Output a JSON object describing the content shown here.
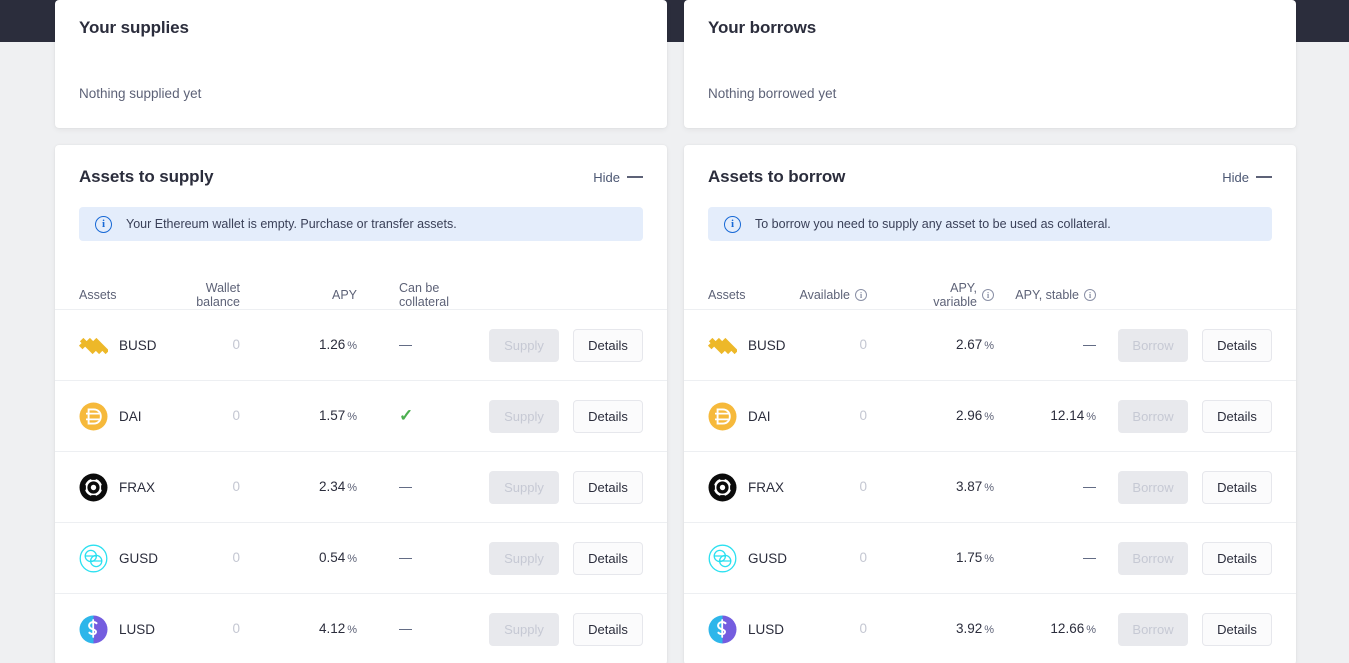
{
  "supplies_panel": {
    "title": "Your supplies",
    "empty_text": "Nothing supplied yet"
  },
  "borrows_panel": {
    "title": "Your borrows",
    "empty_text": "Nothing borrowed yet"
  },
  "supply_table": {
    "title": "Assets to supply",
    "hide_label": "Hide",
    "alert": "Your Ethereum wallet is empty. Purchase or transfer assets.",
    "headers": {
      "assets": "Assets",
      "wallet_balance": "Wallet balance",
      "apy": "APY",
      "can_be_collateral": "Can be collateral"
    },
    "action_label": "Supply",
    "details_label": "Details",
    "rows": [
      {
        "symbol": "BUSD",
        "icon": "busd-icon",
        "balance": "0",
        "apy": "1.26",
        "unit": "%",
        "collateral": "no"
      },
      {
        "symbol": "DAI",
        "icon": "dai-icon",
        "balance": "0",
        "apy": "1.57",
        "unit": "%",
        "collateral": "yes"
      },
      {
        "symbol": "FRAX",
        "icon": "frax-icon",
        "balance": "0",
        "apy": "2.34",
        "unit": "%",
        "collateral": "no"
      },
      {
        "symbol": "GUSD",
        "icon": "gusd-icon",
        "balance": "0",
        "apy": "0.54",
        "unit": "%",
        "collateral": "no"
      },
      {
        "symbol": "LUSD",
        "icon": "lusd-icon",
        "balance": "0",
        "apy": "4.12",
        "unit": "%",
        "collateral": "no"
      }
    ]
  },
  "borrow_table": {
    "title": "Assets to borrow",
    "hide_label": "Hide",
    "alert": "To borrow you need to supply any asset to be used as collateral.",
    "headers": {
      "assets": "Assets",
      "available": "Available",
      "apy_variable": "APY, variable",
      "apy_stable": "APY, stable"
    },
    "action_label": "Borrow",
    "details_label": "Details",
    "rows": [
      {
        "symbol": "BUSD",
        "icon": "busd-icon",
        "available": "0",
        "apy_variable": "2.67",
        "apy_stable": "—",
        "unit": "%"
      },
      {
        "symbol": "DAI",
        "icon": "dai-icon",
        "available": "0",
        "apy_variable": "2.96",
        "apy_stable": "12.14",
        "unit": "%"
      },
      {
        "symbol": "FRAX",
        "icon": "frax-icon",
        "available": "0",
        "apy_variable": "3.87",
        "apy_stable": "—",
        "unit": "%"
      },
      {
        "symbol": "GUSD",
        "icon": "gusd-icon",
        "available": "0",
        "apy_variable": "1.75",
        "apy_stable": "—",
        "unit": "%"
      },
      {
        "symbol": "LUSD",
        "icon": "lusd-icon",
        "available": "0",
        "apy_variable": "3.92",
        "apy_stable": "12.66",
        "unit": "%"
      }
    ]
  },
  "glyphs": {
    "info": "i",
    "dash": "—",
    "check": "✓",
    "percent": "%"
  },
  "colors": {
    "topbar": "#2B2D3C",
    "page_bg": "#EFF0F2",
    "card_bg": "#FFFFFF",
    "alert_bg": "#E4EDFB",
    "info_blue": "#1769D6",
    "check_green": "#4CAF50",
    "muted": "#5D6277"
  }
}
